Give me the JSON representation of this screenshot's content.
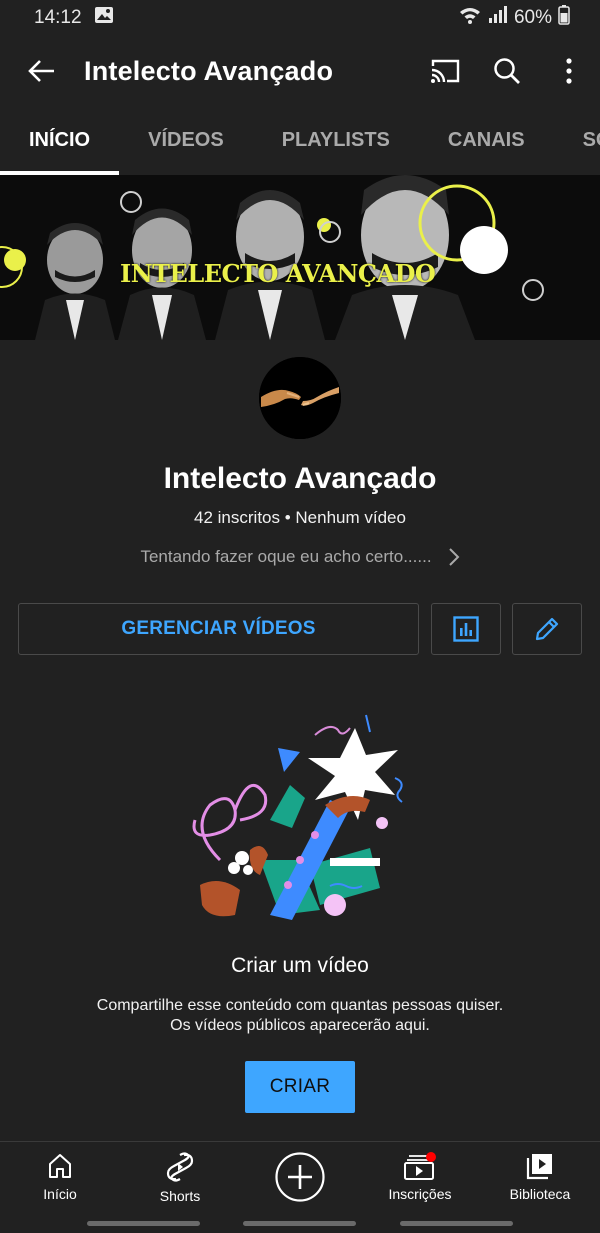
{
  "status_bar": {
    "time": "14:12",
    "battery": "60%"
  },
  "app_bar": {
    "title": "Intelecto Avançado",
    "icons": [
      "back-arrow-icon",
      "cast-icon",
      "search-icon",
      "more-vert-icon"
    ]
  },
  "tabs": [
    {
      "label": "INÍCIO",
      "active": true
    },
    {
      "label": "VÍDEOS",
      "active": false
    },
    {
      "label": "PLAYLISTS",
      "active": false
    },
    {
      "label": "CANAIS",
      "active": false
    },
    {
      "label": "SOBRE",
      "active": false
    }
  ],
  "banner": {
    "text": "INTELECTO AVANÇADO"
  },
  "channel": {
    "name": "Intelecto Avançado",
    "stats": "42 inscritos • Nenhum vídeo",
    "description": "Tentando fazer oque eu acho certo......"
  },
  "actions": {
    "manage_label": "GERENCIAR VÍDEOS",
    "analytics_icon": "analytics-icon",
    "edit_icon": "edit-pencil-icon"
  },
  "empty_state": {
    "title": "Criar um vídeo",
    "line1": "Compartilhe esse conteúdo com quantas pessoas quiser.",
    "line2": "Os vídeos públicos aparecerão aqui.",
    "button": "CRIAR"
  },
  "bottom_nav": [
    {
      "label": "Início",
      "icon": "home-icon"
    },
    {
      "label": "Shorts",
      "icon": "shorts-icon"
    },
    {
      "label": "",
      "icon": "create-plus-icon"
    },
    {
      "label": "Inscrições",
      "icon": "subscriptions-icon"
    },
    {
      "label": "Biblioteca",
      "icon": "library-icon"
    }
  ],
  "colors": {
    "background": "#212121",
    "accent": "#3ea6ff",
    "banner_yellow": "#eaf04a",
    "notification": "#ff0000"
  }
}
